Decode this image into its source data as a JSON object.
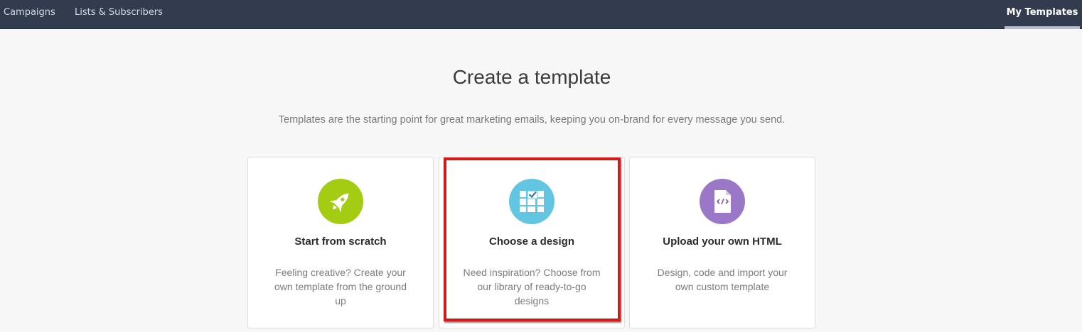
{
  "nav": {
    "campaigns": "Campaigns",
    "lists": "Lists & Subscribers",
    "templates": "My Templates"
  },
  "page": {
    "title": "Create a template",
    "subtitle": "Templates are the starting point for great marketing emails, keeping you on-brand for every message you send."
  },
  "cards": [
    {
      "title": "Start from scratch",
      "description": "Feeling creative? Create your own template from the ground up",
      "icon": "rocket-icon",
      "color": "#a3cc12"
    },
    {
      "title": "Choose a design",
      "description": "Need inspiration? Choose from our library of ready-to-go designs",
      "icon": "design-grid-icon",
      "color": "#62c6e3",
      "highlighted": true
    },
    {
      "title": "Upload your own HTML",
      "description": "Design, code and import your own custom template",
      "icon": "html-file-icon",
      "color": "#9b78c7"
    }
  ],
  "colors": {
    "topbar": "#333c4e",
    "highlight": "#d01b1b",
    "background": "#f7f7f7"
  }
}
